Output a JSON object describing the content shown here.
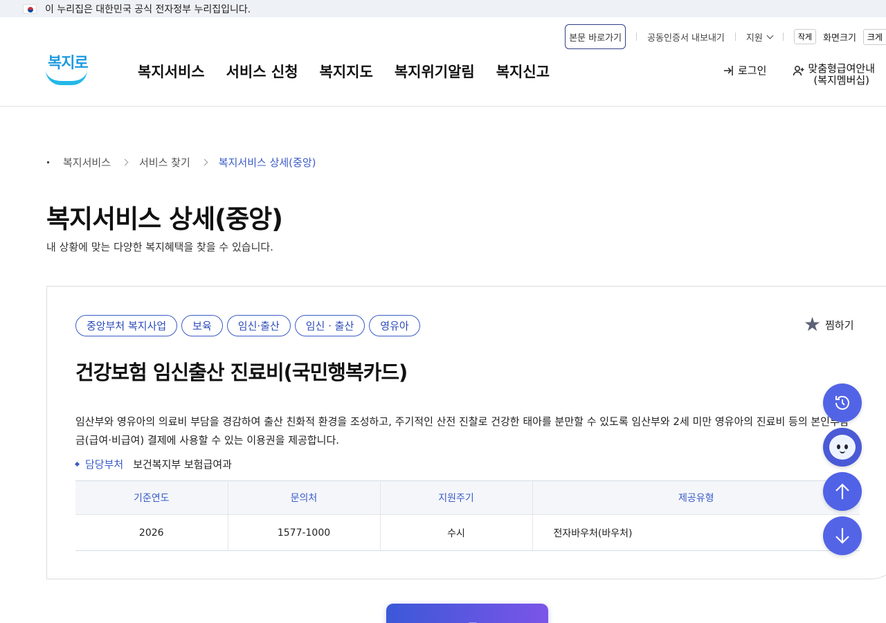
{
  "gov_banner": {
    "text": "이 누리집은 대한민국 공식 전자정부 누리집입니다."
  },
  "utility": {
    "skip_link": "본문 바로가기",
    "cert_export": "공동인증서 내보내기",
    "support": "지원",
    "font_small": "작게",
    "font_label": "화면크기",
    "font_large": "크게"
  },
  "logo": {
    "text": "복지로"
  },
  "gnb": [
    {
      "label": "복지서비스"
    },
    {
      "label": "서비스 신청"
    },
    {
      "label": "복지지도"
    },
    {
      "label": "복지위기알림"
    },
    {
      "label": "복지신고"
    }
  ],
  "member": {
    "login": "로그인",
    "membership_line1": "맞춤형급여안내",
    "membership_line2": "(복지멤버십)"
  },
  "breadcrumb": {
    "item1": "복지서비스",
    "item2": "서비스 찾기",
    "current": "복지서비스 상세(중앙)"
  },
  "page": {
    "title": "복지서비스 상세(중앙)",
    "description": "내 상황에 맞는 다양한 복지혜택을 찾을 수 있습니다."
  },
  "service": {
    "tags": [
      "중앙부처 복지사업",
      "보육",
      "임신·출산",
      "임신 · 출산",
      "영유아"
    ],
    "favorite_label": "찜하기",
    "title": "건강보험 임신출산 진료비(국민행복카드)",
    "description": "임산부와 영유아의 의료비 부담을 경감하여 출산 친화적 환경을 조성하고, 주기적인 산전 진찰로 건강한 태아를 분만할 수 있도록 임산부와 2세 미만 영유아의 진료비 등의 본인부담금(급여·비급여) 결제에 사용할 수 있는 이용권을 제공합니다.",
    "dept_label": "담당부처",
    "dept_value": "보건복지부 보험급여과",
    "table": {
      "headers": [
        "기준연도",
        "문의처",
        "지원주기",
        "제공유형"
      ],
      "row": [
        "2026",
        "1577-1000",
        "수시",
        "전자바우처(바우처)"
      ]
    }
  },
  "bottom_button": {
    "label": "목록"
  },
  "colors": {
    "accent": "#3a5bc7",
    "fab": "#5264e6"
  }
}
